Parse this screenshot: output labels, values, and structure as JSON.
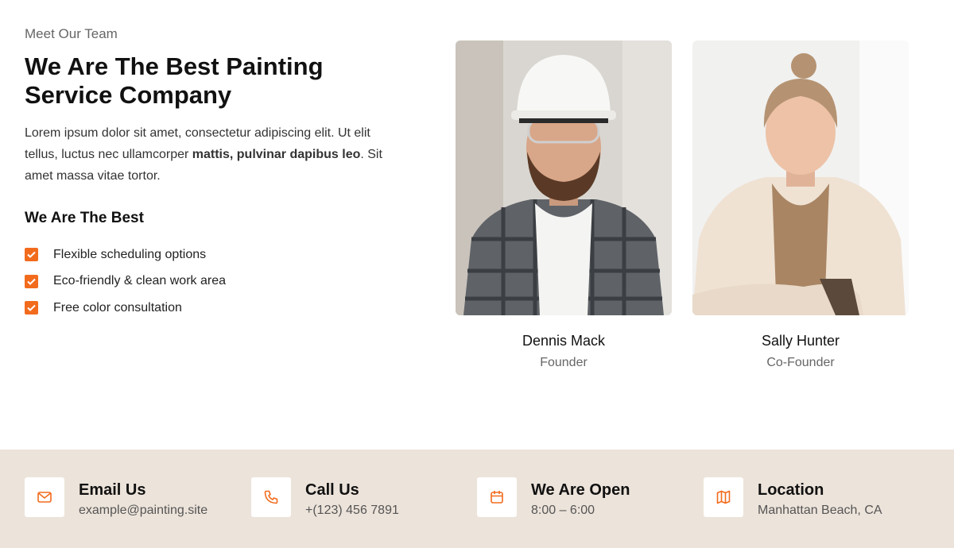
{
  "intro": {
    "eyebrow": "Meet Our Team",
    "title": "We Are The Best Painting Service Company",
    "desc_part1": "Lorem ipsum dolor sit amet, consectetur adipiscing elit. Ut elit tellus, luctus nec ullamcorper ",
    "desc_bold": "mattis, pulvinar dapibus leo",
    "desc_part2": ". Sit amet massa vitae tortor.",
    "subhead": "We Are The Best",
    "features": [
      "Flexible scheduling options",
      "Eco-friendly & clean work area",
      "Free color consultation"
    ]
  },
  "team": [
    {
      "name": "Dennis Mack",
      "role": "Founder"
    },
    {
      "name": "Sally Hunter",
      "role": "Co-Founder"
    }
  ],
  "contacts": [
    {
      "icon": "mail-icon",
      "title": "Email Us",
      "value": "example@painting.site"
    },
    {
      "icon": "phone-icon",
      "title": "Call Us",
      "value": "+(123) 456 7891"
    },
    {
      "icon": "calendar-icon",
      "title": "We Are Open",
      "value": "8:00 – 6:00"
    },
    {
      "icon": "map-icon",
      "title": "Location",
      "value": "Manhattan Beach, CA"
    }
  ],
  "colors": {
    "accent": "#f26b1d",
    "footer_bg": "#ece3da"
  }
}
